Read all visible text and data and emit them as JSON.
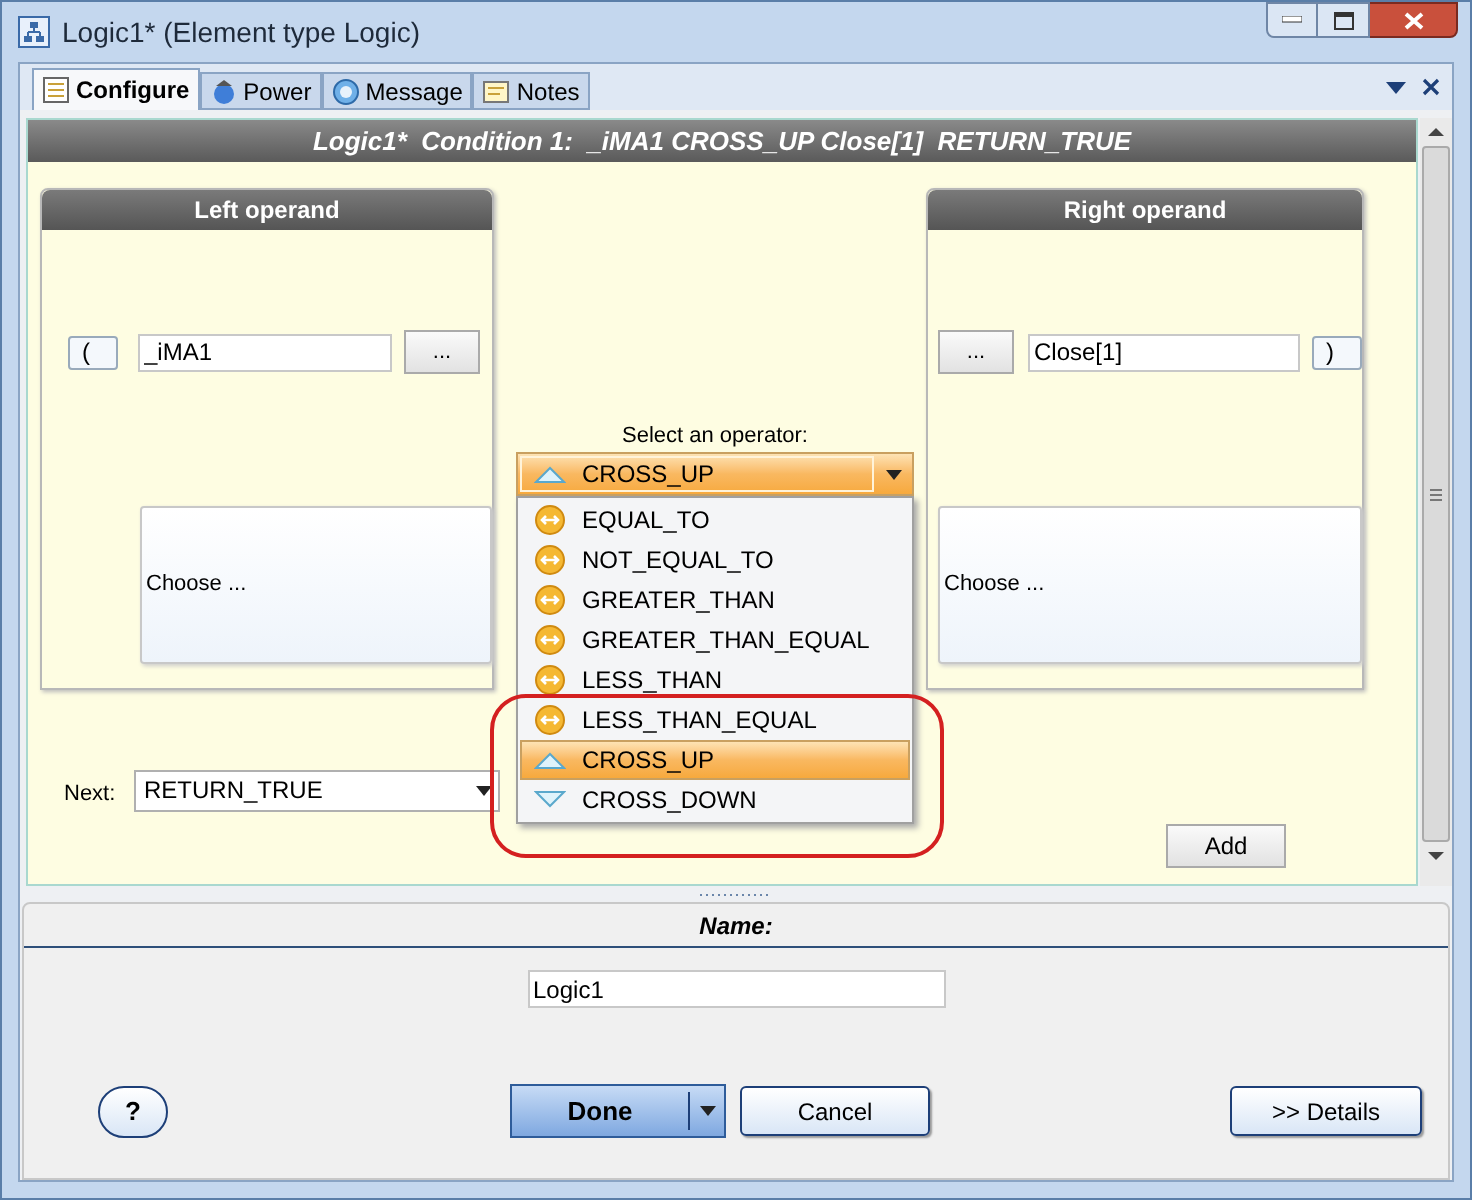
{
  "window": {
    "title": "Logic1* (Element type Logic)"
  },
  "tabs": [
    {
      "label": "Configure",
      "kind": "configure",
      "selected": true
    },
    {
      "label": "Power",
      "kind": "power",
      "selected": false
    },
    {
      "label": "Message",
      "kind": "message",
      "selected": false
    },
    {
      "label": "Notes",
      "kind": "notes",
      "selected": false
    }
  ],
  "header": "Logic1*  Condition 1:  _iMA1 CROSS_UP Close[1]  RETURN_TRUE",
  "left_operand": {
    "title": "Left operand",
    "paren": "(",
    "value": "_iMA1",
    "browse": "...",
    "choose": "Choose ..."
  },
  "operator": {
    "label": "Select an operator:",
    "value": {
      "label": "CROSS_UP",
      "kind": "cross_up"
    },
    "expanded": true,
    "items": [
      {
        "label": "EQUAL_TO",
        "kind": "compare",
        "selected": false
      },
      {
        "label": "NOT_EQUAL_TO",
        "kind": "compare",
        "selected": false
      },
      {
        "label": "GREATER_THAN",
        "kind": "compare",
        "selected": false
      },
      {
        "label": "GREATER_THAN_EQUAL",
        "kind": "compare",
        "selected": false
      },
      {
        "label": "LESS_THAN",
        "kind": "compare",
        "selected": false
      },
      {
        "label": "LESS_THAN_EQUAL",
        "kind": "compare",
        "selected": false
      },
      {
        "label": "CROSS_UP",
        "kind": "cross_up",
        "selected": true
      },
      {
        "label": "CROSS_DOWN",
        "kind": "cross_down",
        "selected": false
      }
    ]
  },
  "right_operand": {
    "title": "Right operand",
    "browse": "...",
    "value": "Close[1]",
    "paren": ")",
    "choose": "Choose ..."
  },
  "next": {
    "label": "Next:",
    "value": "RETURN_TRUE"
  },
  "add_button": "Add",
  "name": {
    "label": "Name:",
    "value": "Logic1"
  },
  "buttons": {
    "help": "?",
    "done": "Done",
    "cancel": "Cancel",
    "details": ">> Details"
  }
}
